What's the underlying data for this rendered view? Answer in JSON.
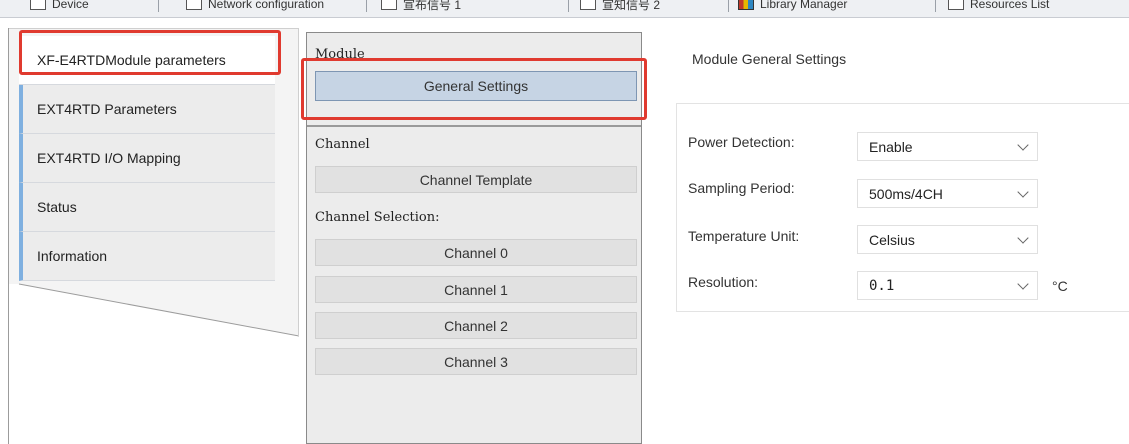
{
  "top_tabs": [
    {
      "label": "Device",
      "icon": "device-icon"
    },
    {
      "label": "Network configuration",
      "icon": "network-icon"
    },
    {
      "label": "宣布信号 1",
      "icon": "document-icon"
    },
    {
      "label": "宣知信号 2",
      "icon": "document-icon"
    },
    {
      "label": "Library Manager",
      "icon": "library-icon"
    },
    {
      "label": "Resources List",
      "icon": "list-icon"
    }
  ],
  "sidebar": {
    "items": [
      {
        "label": "XF-E4RTDModule parameters",
        "active": true
      },
      {
        "label": "EXT4RTD Parameters",
        "active": false
      },
      {
        "label": "EXT4RTD I/O Mapping",
        "active": false
      },
      {
        "label": "Status",
        "active": false
      },
      {
        "label": "Information",
        "active": false
      }
    ]
  },
  "middle": {
    "module_label": "Module",
    "general_settings": "General Settings",
    "channel_label": "Channel",
    "channel_template": "Channel Template",
    "channel_selection_label": "Channel Selection:",
    "channels": [
      "Channel 0",
      "Channel 1",
      "Channel 2",
      "Channel 3"
    ]
  },
  "settings": {
    "title": "Module General Settings",
    "rows": [
      {
        "label": "Power Detection:",
        "value": "Enable"
      },
      {
        "label": "Sampling Period:",
        "value": "500ms/4CH"
      },
      {
        "label": "Temperature Unit:",
        "value": "Celsius"
      },
      {
        "label": "Resolution:",
        "value": "0.1"
      }
    ],
    "resolution_unit": "°C"
  },
  "colors": {
    "highlight_red": "#e03a2f",
    "selected_button": "#c6d4e4",
    "nav_accent": "#7fb0e0"
  }
}
